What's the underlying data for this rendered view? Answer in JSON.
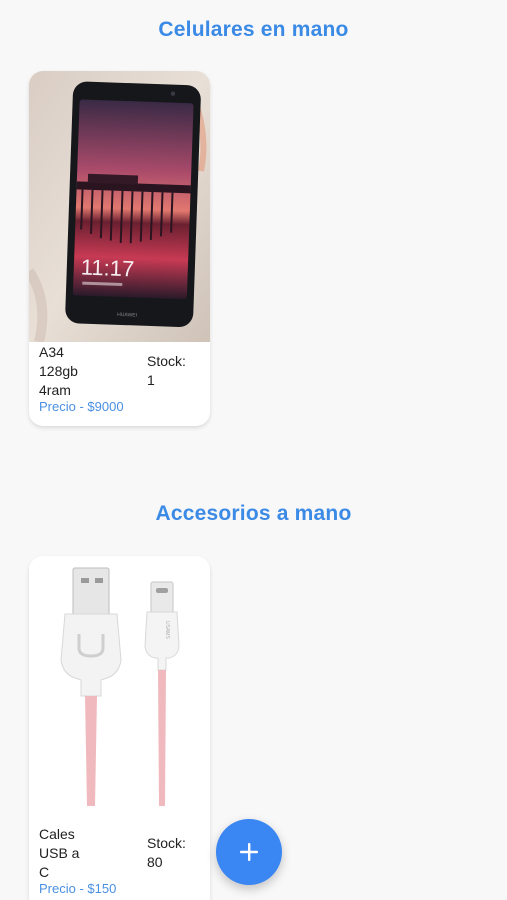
{
  "sections": {
    "phones": {
      "title": "Celulares en mano",
      "item": {
        "name": "A34\n128gb\n4ram",
        "stock": "Stock:\n1",
        "price": "Precio - $9000",
        "image": "photo of a Huawei smartphone with pier-at-sunset lock screen showing 11:17"
      }
    },
    "accessories": {
      "title": "Accesorios a mano",
      "item": {
        "name": "Cales\nUSB a\nC",
        "stock": "Stock:\n80",
        "price": "Precio - $150",
        "image": "product photo of pink USB-A to USB-C cable"
      }
    }
  },
  "fab": {
    "icon": "plus-icon"
  },
  "colors": {
    "accent": "#3b8ae6",
    "fab": "#3a86f2",
    "price": "#4a90e2",
    "background": "#f8f8f8"
  }
}
